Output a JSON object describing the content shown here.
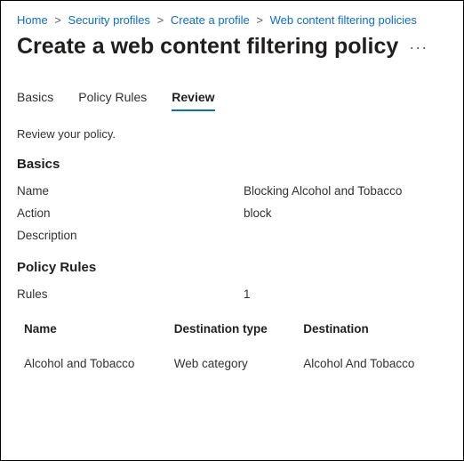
{
  "breadcrumb": [
    {
      "label": "Home"
    },
    {
      "label": "Security profiles"
    },
    {
      "label": "Create a profile"
    },
    {
      "label": "Web content filtering policies"
    }
  ],
  "title": "Create a web content filtering policy",
  "more_icon": "···",
  "tabs": [
    {
      "label": "Basics",
      "active": false
    },
    {
      "label": "Policy Rules",
      "active": false
    },
    {
      "label": "Review",
      "active": true
    }
  ],
  "intro": "Review your policy.",
  "sections": {
    "basics": {
      "heading": "Basics",
      "fields": {
        "name_label": "Name",
        "name_value": "Blocking Alcohol and Tobacco",
        "action_label": "Action",
        "action_value": "block",
        "description_label": "Description",
        "description_value": ""
      }
    },
    "policy_rules": {
      "heading": "Policy Rules",
      "rules_label": "Rules",
      "rules_count": "1",
      "columns": {
        "name": "Name",
        "dest_type": "Destination type",
        "dest": "Destination"
      },
      "rows": [
        {
          "name": "Alcohol and Tobacco",
          "dest_type": "Web category",
          "dest": "Alcohol And Tobacco"
        }
      ]
    }
  }
}
